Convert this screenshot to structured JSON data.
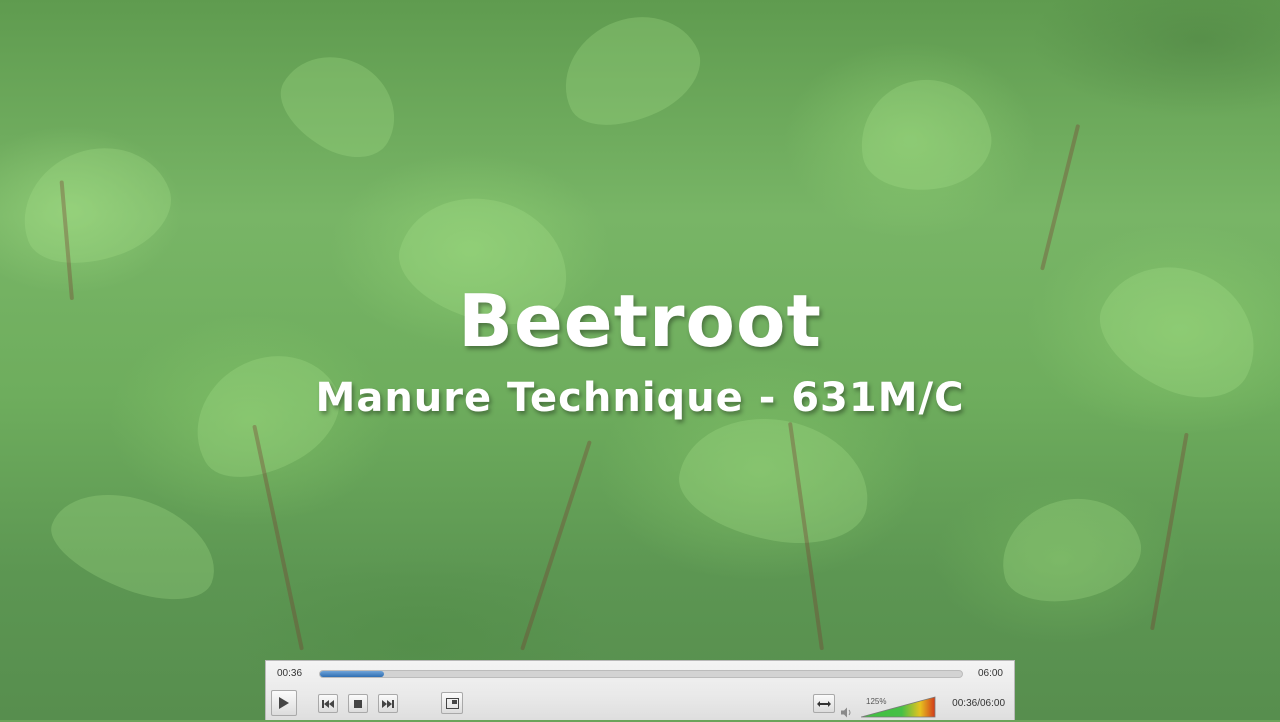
{
  "video": {
    "title": "Beetroot",
    "subtitle": "Manure Technique - 631M/C"
  },
  "player": {
    "elapsed": "00:36",
    "duration": "06:00",
    "progress_fraction": 0.1,
    "volume_percent": "125%",
    "time_display": "00:36/06:00",
    "accent_color": "#2f6fb3",
    "buttons": {
      "play": "play-icon",
      "previous": "skip-previous-icon",
      "stop": "stop-icon",
      "next": "skip-next-icon",
      "fullscreen": "fullscreen-icon",
      "frame_toggle": "aspect-ratio-icon",
      "volume": "speaker-icon"
    }
  }
}
